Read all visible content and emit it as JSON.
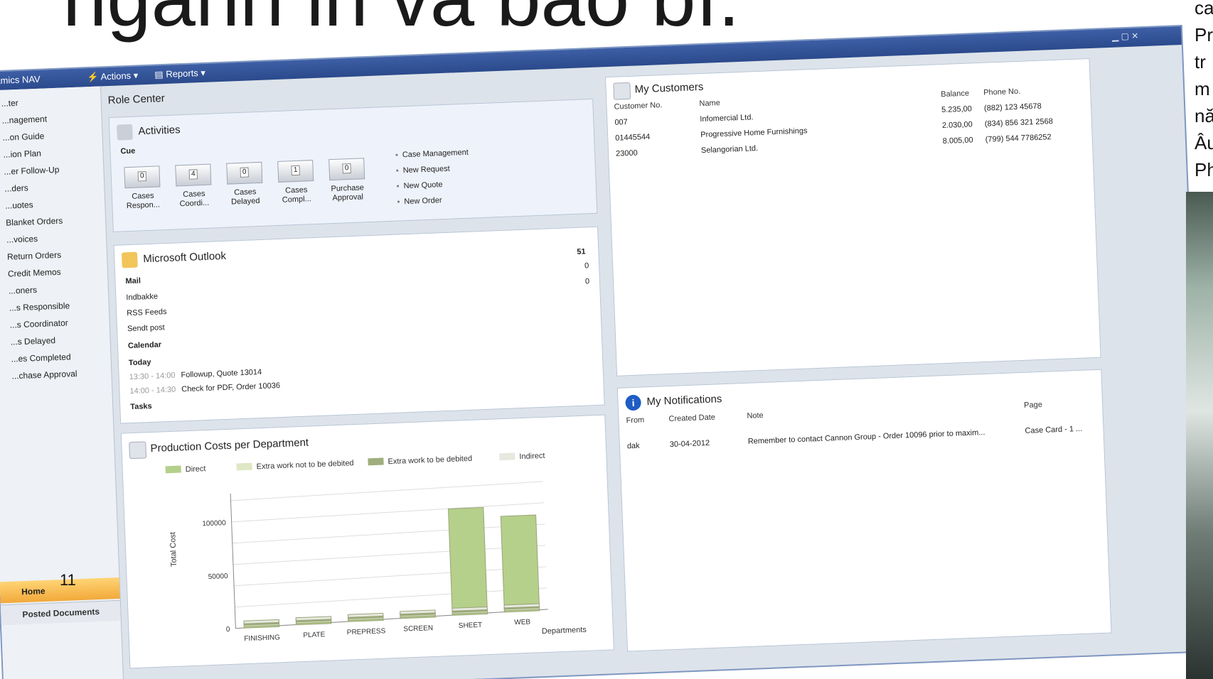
{
  "slide": {
    "title": "ngành in và bao bì.",
    "page_number": "11",
    "right_text_lines": [
      "ca",
      "Pr",
      "tr",
      "m",
      "nă",
      "Âu",
      "Ph"
    ]
  },
  "window": {
    "app_menu": "...amics NAV",
    "actions_menu": "Actions",
    "reports_menu": "Reports"
  },
  "sidebar": {
    "items": [
      "...ter",
      "...nagement",
      "...on Guide",
      "...ion Plan",
      "...er Follow-Up",
      "...ders",
      "...uotes",
      "Blanket Orders",
      "...voices",
      "Return Orders",
      "Credit Memos",
      "...oners",
      "...s Responsible",
      "...s Coordinator",
      "...s Delayed",
      "...es Completed",
      "...chase Approval"
    ],
    "home_label": "Home",
    "posted_label": "Posted Documents"
  },
  "role_center": {
    "title": "Role Center",
    "activities": {
      "title": "Activities",
      "section": "Cue",
      "cues": [
        {
          "count": "0",
          "label": "Cases Respon..."
        },
        {
          "count": "4",
          "label": "Cases Coordi..."
        },
        {
          "count": "0",
          "label": "Cases Delayed"
        },
        {
          "count": "1",
          "label": "Cases Compl..."
        },
        {
          "count": "0",
          "label": "Purchase Approval"
        }
      ],
      "actions": [
        "Case Management",
        "New Request",
        "New Quote",
        "New Order"
      ]
    },
    "outlook": {
      "title": "Microsoft Outlook",
      "mail_header": "Mail",
      "mail_count": "51",
      "mail_rows": [
        {
          "label": "Indbakke",
          "value": "0"
        },
        {
          "label": "RSS Feeds",
          "value": "0"
        },
        {
          "label": "Sendt post",
          "value": ""
        }
      ],
      "calendar_header": "Calendar",
      "today_label": "Today",
      "events": [
        {
          "time": "13:30 - 14:00",
          "text": "Followup, Quote 13014"
        },
        {
          "time": "14:00 - 14:30",
          "text": "Check for PDF, Order 10036"
        }
      ],
      "tasks_header": "Tasks"
    },
    "production_chart": {
      "title": "Production Costs per Department"
    }
  },
  "customers": {
    "title": "My Customers",
    "columns": [
      "Customer No.",
      "Name",
      "Balance",
      "Phone No."
    ],
    "rows": [
      {
        "no": "007",
        "name": "Infomercial Ltd.",
        "balance": "5.235,00",
        "phone": "(882) 123 45678"
      },
      {
        "no": "01445544",
        "name": "Progressive Home Furnishings",
        "balance": "2.030,00",
        "phone": "(834) 856 321 2568"
      },
      {
        "no": "23000",
        "name": "Selangorian Ltd.",
        "balance": "8.005,00",
        "phone": "(799) 544 7786252"
      }
    ]
  },
  "notifications": {
    "title": "My Notifications",
    "columns": [
      "From",
      "Created Date",
      "Note",
      "Page"
    ],
    "rows": [
      {
        "from": "dak",
        "date": "30-04-2012",
        "note": "Remember to contact Cannon Group - Order 10096 prior to maxim...",
        "page": "Case Card - 1 ..."
      }
    ]
  },
  "chart_data": {
    "type": "bar",
    "title": "Production Costs per Department",
    "xlabel": "Departments",
    "ylabel": "Total Cost",
    "categories": [
      "FINISHING",
      "PLATE",
      "PREPRESS",
      "SCREEN",
      "SHEET",
      "WEB"
    ],
    "series": [
      {
        "name": "Direct",
        "values": [
          0,
          0,
          0,
          0,
          100000,
          90000
        ]
      },
      {
        "name": "Extra work not to be debited",
        "values": [
          0,
          0,
          0,
          0,
          0,
          0
        ]
      },
      {
        "name": "Extra work to be debited",
        "values": [
          0,
          0,
          0,
          0,
          0,
          0
        ]
      },
      {
        "name": "Indirect",
        "values": [
          0,
          0,
          0,
          0,
          0,
          0
        ]
      }
    ],
    "yticks": [
      "0",
      "50000",
      "100000"
    ],
    "ylim": [
      0,
      120000
    ],
    "legend": "top",
    "colors": {
      "Direct": "#b5d08a",
      "Extra work not to be debited": "#dfe8c4",
      "Extra work to be debited": "#9fae7c",
      "Indirect": "#e6e9df"
    }
  }
}
